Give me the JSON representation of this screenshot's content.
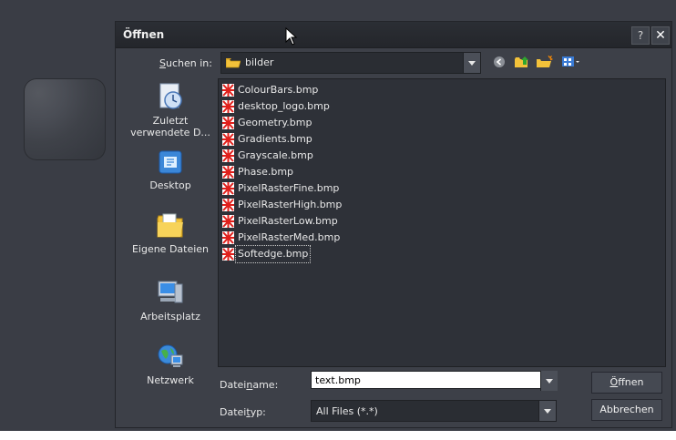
{
  "dialog": {
    "title": "Öffnen",
    "help_glyph": "?",
    "close_glyph": "✕"
  },
  "lookin": {
    "label_pre": "",
    "label_access": "S",
    "label_post": "uchen in:",
    "value": "bilder"
  },
  "toolbar": {
    "icons": [
      "back-icon",
      "up-folder-icon",
      "new-folder-icon",
      "view-menu-icon"
    ]
  },
  "places": [
    {
      "label": "Zuletzt verwendete D...",
      "icon": "recent-documents-icon"
    },
    {
      "label": "Desktop",
      "icon": "desktop-icon"
    },
    {
      "label": "Eigene Dateien",
      "icon": "my-documents-icon"
    },
    {
      "label": "Arbeitsplatz",
      "icon": "my-computer-icon"
    },
    {
      "label": "Netzwerk",
      "icon": "network-icon"
    }
  ],
  "files": [
    "ColourBars.bmp",
    "desktop_logo.bmp",
    "Geometry.bmp",
    "Gradients.bmp",
    "Grayscale.bmp",
    "Phase.bmp",
    "PixelRasterFine.bmp",
    "PixelRasterHigh.bmp",
    "PixelRasterLow.bmp",
    "PixelRasterMed.bmp",
    "Softedge.bmp"
  ],
  "filename": {
    "label_pre": "Datei",
    "label_access": "n",
    "label_post": "ame:",
    "value": "text.bmp"
  },
  "filetype": {
    "label_pre": "Datei",
    "label_access": "t",
    "label_post": "yp:",
    "value": "All Files (*.*)"
  },
  "buttons": {
    "open_access": "Ö",
    "open_post": "ffnen",
    "cancel": "Abbrechen"
  },
  "colors": {
    "backdrop": "#3a3d45",
    "dialog": "#3d4048",
    "list_bg": "#2e3138",
    "bmp_icon_red": "#e0201c"
  }
}
